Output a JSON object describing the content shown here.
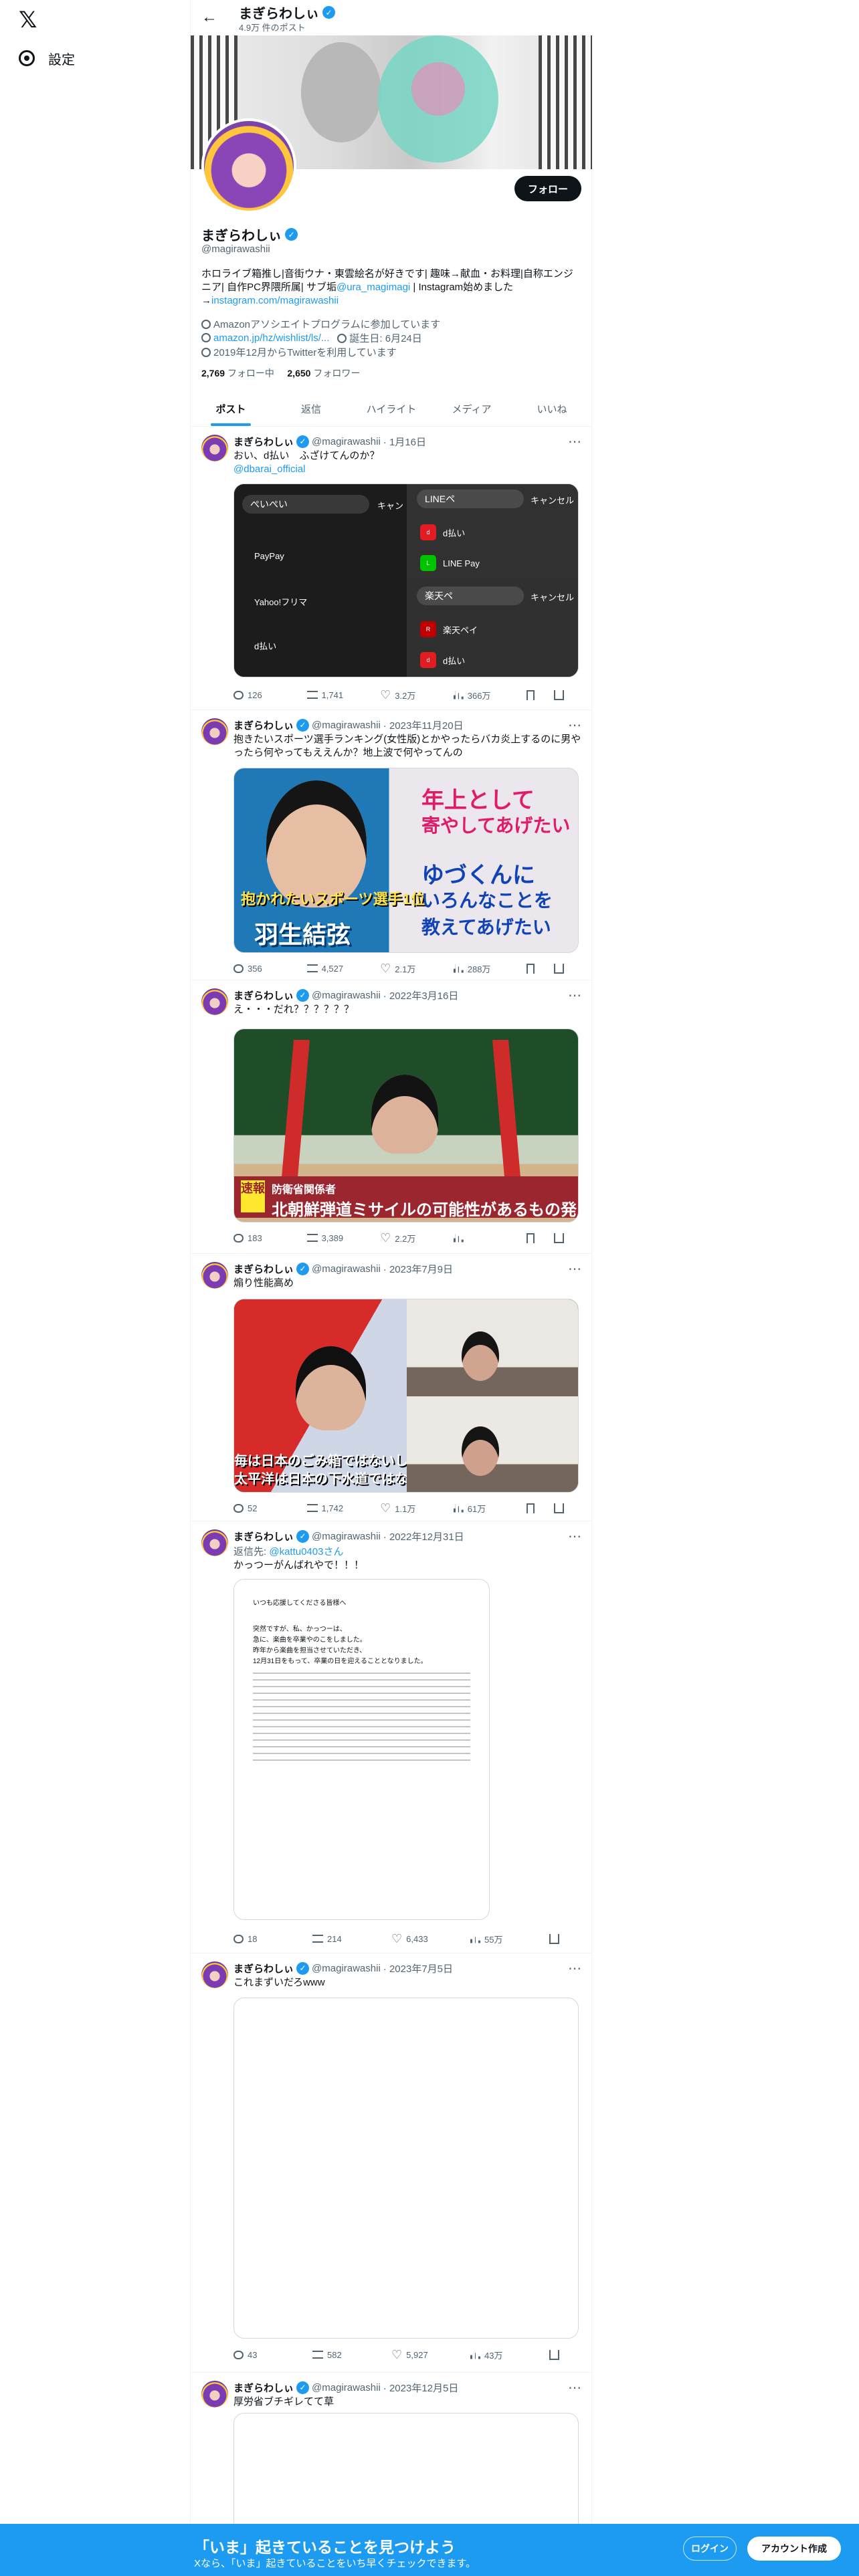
{
  "app": {
    "logo": "𝕏",
    "settings": "設定"
  },
  "header": {
    "title": "まぎらわしぃ",
    "post_count": "4.9万 件のポスト"
  },
  "profile": {
    "name": "まぎらわしぃ",
    "handle": "@magirawashii",
    "follow": "フォロー",
    "bio_text": "ホロライブ箱推し|音街ウナ・東雲絵名が好きです| 趣味→献血・お料理|自称エンジニア| 自作PC界隈所属| サブ垢",
    "bio_link": "@ura_magimagi",
    "bio_after": " | Instagram始めました",
    "bio_url": "instagram.com/magirawashii",
    "affiliate": "Amazonアソシエイトプログラムに参加しています",
    "amazon": "amazon.jp/hz/wishlist/ls/...",
    "birthday": "誕生日: 6月24日",
    "joined": "2019年12月からTwitterを利用しています",
    "following_count": "2,769",
    "following_label": "フォロー中",
    "followers_count": "2,650",
    "followers_label": "フォロワー"
  },
  "tabs": [
    {
      "label": "ポスト"
    },
    {
      "label": "返信"
    },
    {
      "label": "ハイライト"
    },
    {
      "label": "メディア"
    },
    {
      "label": "いいね"
    }
  ],
  "tweets": [
    {
      "name": "まぎらわしぃ",
      "handle": "@magirawashii",
      "date": "· 1月16日",
      "text": "おい、d払い　ふざけてんのか？",
      "mention": "@dbarai_official",
      "stats": {
        "replies": "126",
        "retweets": "1,741",
        "likes": "3.2万",
        "views": "366万"
      }
    },
    {
      "name": "まぎらわしぃ",
      "handle": "@magirawashii",
      "date": "· 2023年11月20日",
      "text": "抱きたいスポーツ選手ランキング(女性版)とかやったらバカ炎上するのに男やったら何やってもええんか？地上波で何やってんの",
      "stats": {
        "replies": "356",
        "retweets": "4,527",
        "likes": "2.1万",
        "views": "288万"
      }
    },
    {
      "name": "まぎらわしぃ",
      "handle": "@magirawashii",
      "date": "· 2022年3月16日",
      "text": "え・・・だれ？？？？？？",
      "stats": {
        "replies": "183",
        "retweets": "3,389",
        "likes": "2.2万",
        "views": ""
      }
    },
    {
      "name": "まぎらわしぃ",
      "handle": "@magirawashii",
      "date": "· 2023年7月9日",
      "text": "煽り性能高め",
      "stats": {
        "replies": "52",
        "retweets": "1,742",
        "likes": "1.1万",
        "views": "61万"
      }
    },
    {
      "name": "まぎらわしぃ",
      "handle": "@magirawashii",
      "date": "· 2022年12月31日",
      "reply_to_label": "返信先:",
      "reply_to": "@kattu0403さん",
      "text": "かっつーがんばれやで！！！",
      "stats": {
        "replies": "18",
        "retweets": "214",
        "likes": "6,433",
        "views": "55万"
      }
    },
    {
      "name": "まぎらわしぃ",
      "handle": "@magirawashii",
      "date": "· 2023年7月5日",
      "text": "これまずいだろwww",
      "stats": {
        "replies": "43",
        "retweets": "582",
        "likes": "5,927",
        "views": "43万"
      }
    },
    {
      "name": "まぎらわしぃ",
      "handle": "@magirawashii",
      "date": "· 2023年12月5日",
      "text": "厚労省ブチギレてて草"
    }
  ],
  "media": {
    "payment_search_left": "ぺいぺい",
    "payment_cancel": "キャン",
    "payment_items": [
      "PayPay",
      "Yahoo!フリマ",
      "d払い"
    ],
    "payment_search_right_top": "LINEペ",
    "payment_cancel_right": "キャンセル",
    "payment_top_items": [
      "d払い",
      "LINE Pay"
    ],
    "payment_search_right_bottom": "楽天ペ",
    "payment_bottom_items": [
      "楽天ペイ",
      "d払い"
    ],
    "sports_headline_1": "年上として",
    "sports_headline_2": "寄やしてあげたい",
    "sports_headline_3": "ゆづくんに",
    "sports_headline_4": "いろんなことを",
    "sports_headline_5": "教えてあげたい",
    "sports_rank_label": "抱かれたいスポーツ選手1位",
    "sports_player": "羽生結弦",
    "news_ticker_1": "速報",
    "news_ticker_2": "防衛省関係者",
    "news_ticker_3": "北朝鮮弾道ミサイルの可能性があるもの発射",
    "press_caption_1": "毎は日本のごみ箱ではないし",
    "press_caption_2": "太平洋は日本の下水道ではない",
    "letter_title": "いつも応援してくださる皆様へ",
    "letter_lines": [
      "突然ですが、私、かっつーは、",
      "急に、楽曲を卒業やのこをしました。",
      "昨年から楽曲を担当させていただき、",
      "12月31日をもって、卒業の日を迎えることとなりました。"
    ]
  },
  "signup": {
    "title": "「いま」起きていることを見つけよう",
    "subtitle": "Xなら、「いま」起きていることをいち早くチェックできます。",
    "login": "ログイン",
    "create": "アカウント作成"
  }
}
